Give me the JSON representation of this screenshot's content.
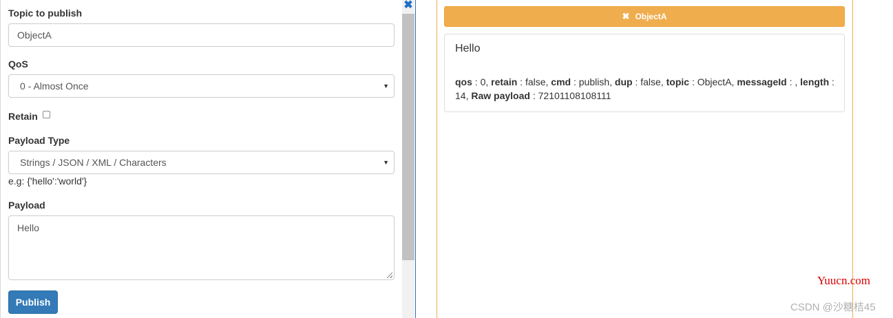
{
  "publish_form": {
    "topic": {
      "label": "Topic to publish",
      "value": "ObjectA"
    },
    "qos": {
      "label": "QoS",
      "selected": "0 - Almost Once"
    },
    "retain": {
      "label": "Retain",
      "checked": false
    },
    "payload_type": {
      "label": "Payload Type",
      "selected": "Strings / JSON / XML / Characters",
      "hint": "e.g: {'hello':'world'}"
    },
    "payload": {
      "label": "Payload",
      "value": "Hello"
    },
    "publish_label": "Publish"
  },
  "panel_close_icon": "close-icon",
  "message_panel": {
    "topic_button": {
      "icon": "close-icon",
      "label": "ObjectA"
    },
    "message": {
      "title": "Hello",
      "fields": [
        {
          "key": "qos",
          "value": "0"
        },
        {
          "key": "retain",
          "value": "false"
        },
        {
          "key": "cmd",
          "value": "publish"
        },
        {
          "key": "dup",
          "value": "false"
        },
        {
          "key": "topic",
          "value": "ObjectA"
        },
        {
          "key": "messageId",
          "value": ""
        },
        {
          "key": "length",
          "value": "14"
        },
        {
          "key": "Raw payload",
          "value": "72101108108111"
        }
      ]
    }
  },
  "watermarks": {
    "site": "Yuucn.com",
    "author": "CSDN @沙糖桔45"
  },
  "colors": {
    "primary": "#337ab7",
    "warning": "#f0ad4e",
    "divider": "#2f6fb3"
  }
}
